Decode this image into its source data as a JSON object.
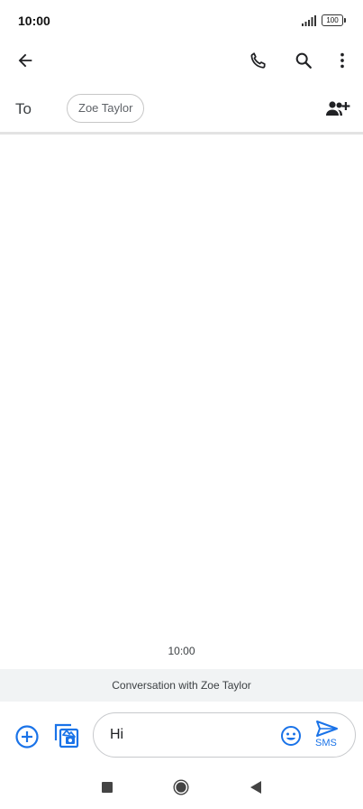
{
  "status": {
    "time": "10:00",
    "battery": "100"
  },
  "toolbar": {
    "back_icon": "arrow-left-icon",
    "call_icon": "phone-icon",
    "search_icon": "search-icon",
    "more_icon": "more-vert-icon"
  },
  "recipients": {
    "to_label": "To",
    "chip": "Zoe Taylor",
    "add_icon": "add-people-icon"
  },
  "conversation": {
    "timestamp": "10:00",
    "banner": "Conversation with Zoe Taylor"
  },
  "compose": {
    "add_icon": "add-circle-icon",
    "gallery_icon": "gallery-icon",
    "message_text": "Hi",
    "emoji_icon": "emoji-icon",
    "send_icon": "send-icon",
    "send_label": "SMS"
  },
  "colors": {
    "accent": "#1a73e8",
    "banner_bg": "#f1f3f4"
  }
}
